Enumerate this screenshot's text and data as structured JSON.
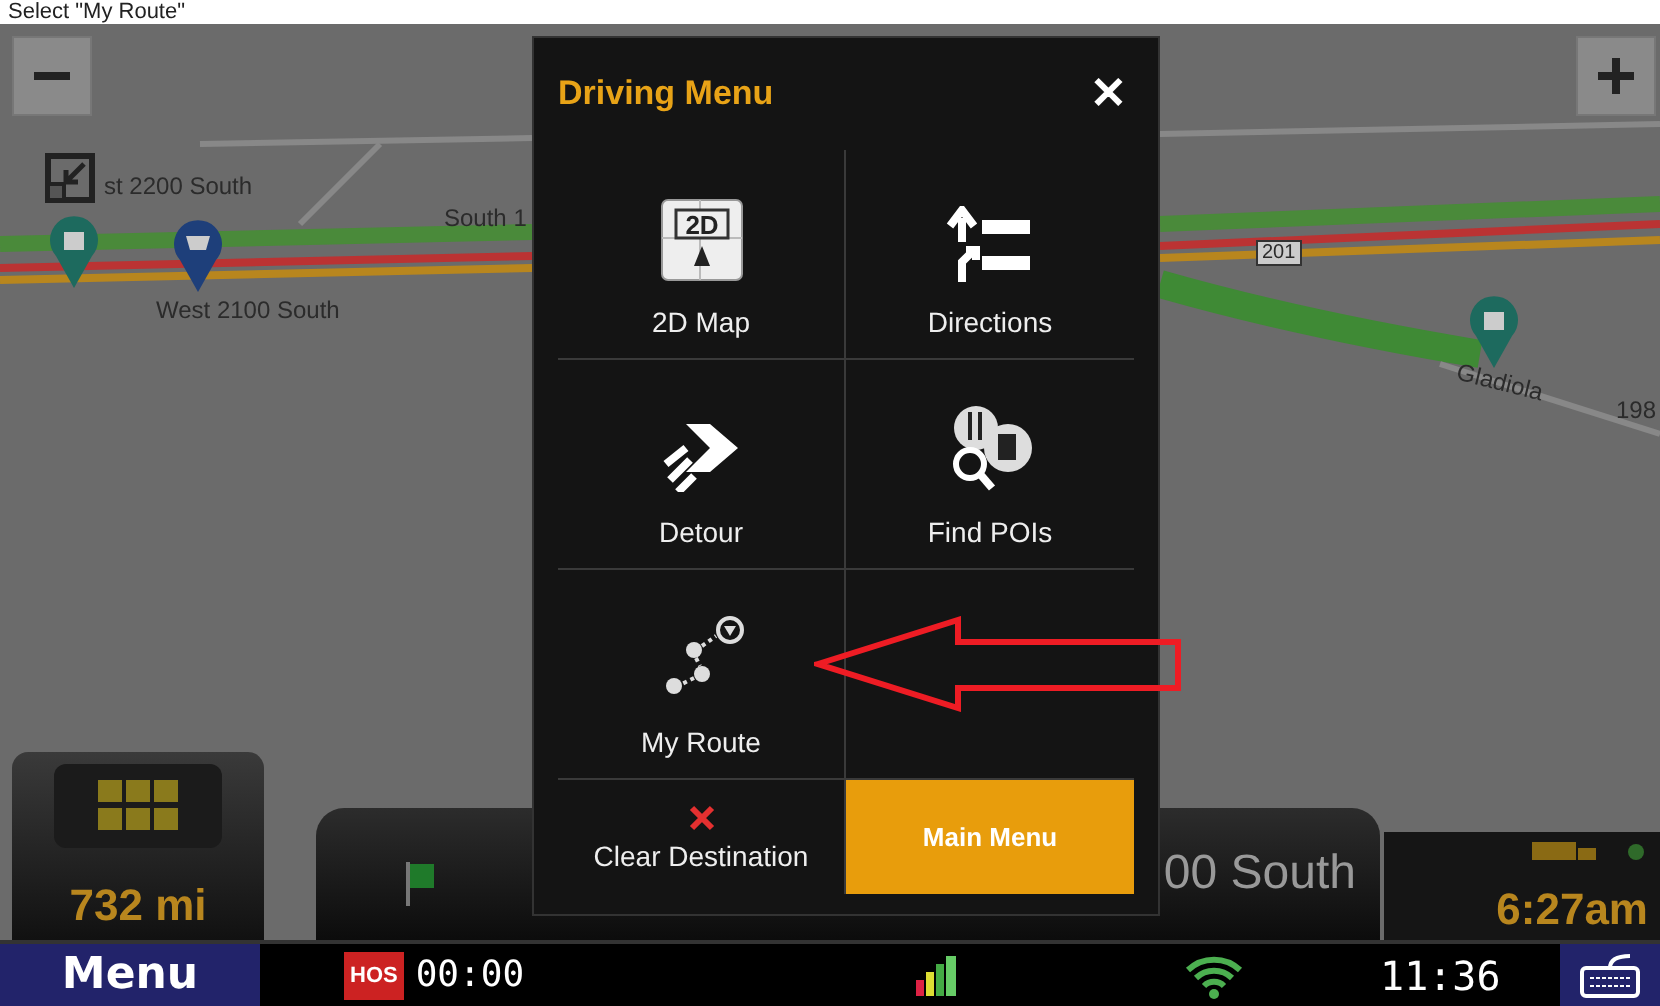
{
  "caption": "Select \"My Route\"",
  "map": {
    "labels": [
      {
        "text": "st 2200 South",
        "kind": "street"
      },
      {
        "text": "South 1",
        "kind": "street"
      },
      {
        "text": "West 2100 South",
        "kind": "street"
      },
      {
        "text": "201",
        "kind": "shield"
      },
      {
        "text": "Gladiola",
        "kind": "street"
      },
      {
        "text": "198",
        "kind": "street"
      }
    ]
  },
  "dashboard": {
    "distance": "732 mi",
    "street": "00 South",
    "eta": "6:27am"
  },
  "dialog": {
    "title": "Driving Menu",
    "close": "✕",
    "rows": [
      [
        {
          "label": "2D Map",
          "kind": "map2d",
          "icon_text": "2D"
        },
        {
          "label": "Directions",
          "kind": "directions"
        }
      ],
      [
        {
          "label": "Detour",
          "kind": "detour"
        },
        {
          "label": "Find POIs",
          "kind": "pois"
        }
      ],
      [
        {
          "label": "My Route",
          "kind": "route"
        }
      ],
      [
        {
          "label": "Clear Destination",
          "kind": "clear"
        },
        {
          "label": "Main Menu",
          "kind": "primary"
        }
      ]
    ]
  },
  "status_bar": {
    "menu": "Menu",
    "hos_badge": "HOS",
    "hos_time": "00:00",
    "clock": "11:36"
  }
}
